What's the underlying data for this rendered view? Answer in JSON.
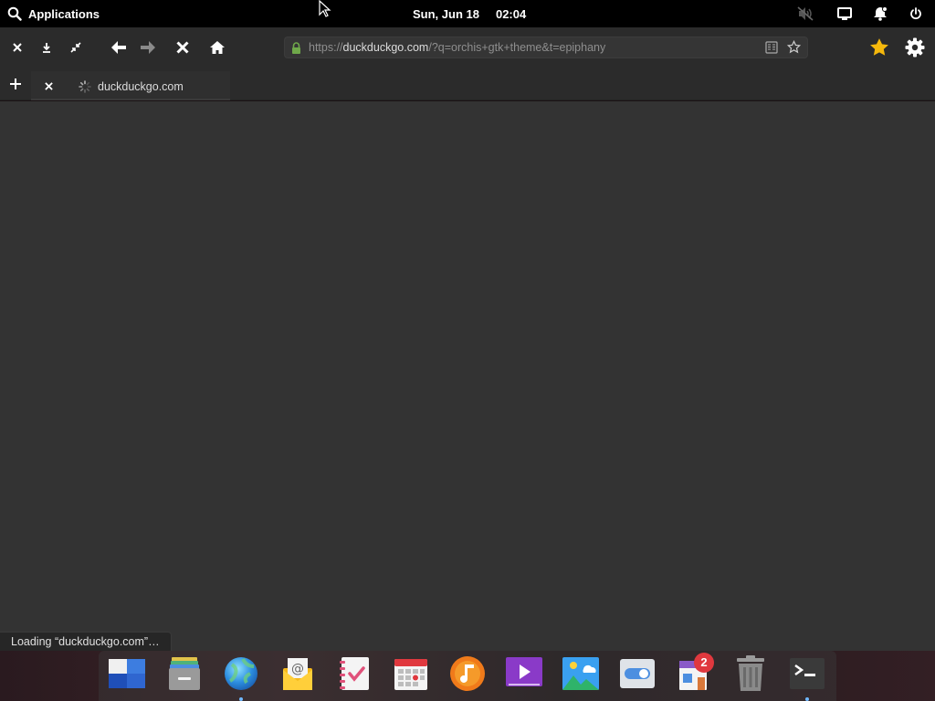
{
  "top_panel": {
    "applications_label": "Applications",
    "date": "Sun, Jun 18",
    "time": "02:04"
  },
  "browser": {
    "url": {
      "prefix": "https://",
      "domain": "duckduckgo.com",
      "path": "/?q=orchis+gtk+theme&t=epiphany"
    },
    "tab": {
      "title": "duckduckgo.com",
      "loading": true
    },
    "status": "Loading “duckduckgo.com”…"
  },
  "dock": {
    "items": [
      "multitasking-view-icon",
      "files-icon",
      "web-browser-icon",
      "mail-icon",
      "tasks-icon",
      "calendar-icon",
      "music-icon",
      "videos-icon",
      "photos-icon",
      "system-settings-icon",
      "appcenter-icon",
      "trash-icon",
      "terminal-icon"
    ],
    "appcenter_badge": "2"
  },
  "colors": {
    "panel": "#000000",
    "headerbar": "#2b2b2b",
    "content": "#333333",
    "bookmark_star": "#f5b80c",
    "lock": "#6fa84a",
    "badge": "#e0383e"
  }
}
